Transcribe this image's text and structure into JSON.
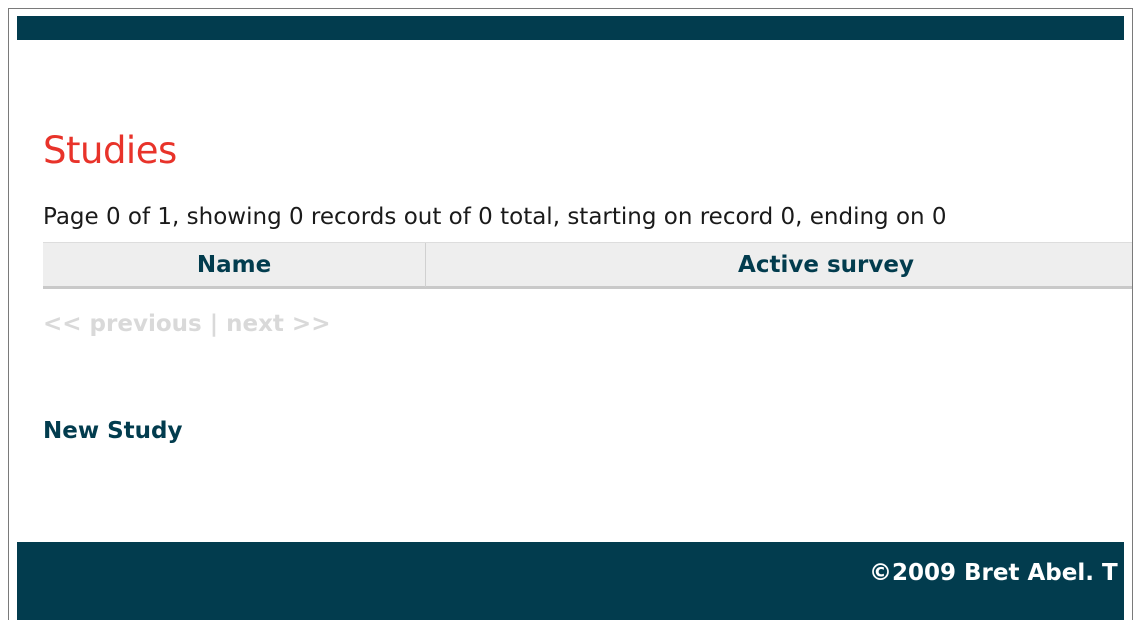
{
  "colors": {
    "brand_dark": "#023c4e",
    "title_red": "#e8332a",
    "pager_disabled": "#d9d9d9",
    "table_header_bg": "#eeeeee"
  },
  "page": {
    "title": "Studies",
    "pagination_info": "Page 0 of 1, showing 0 records out of 0 total, starting on record 0, ending on 0"
  },
  "table": {
    "columns": [
      "Name",
      "Active survey"
    ],
    "rows": []
  },
  "pager": {
    "previous": "<< previous",
    "separator": " | ",
    "next": "next >>"
  },
  "actions": {
    "new_study": "New Study"
  },
  "footer": {
    "copyright": "©2009 Bret Abel. T"
  }
}
